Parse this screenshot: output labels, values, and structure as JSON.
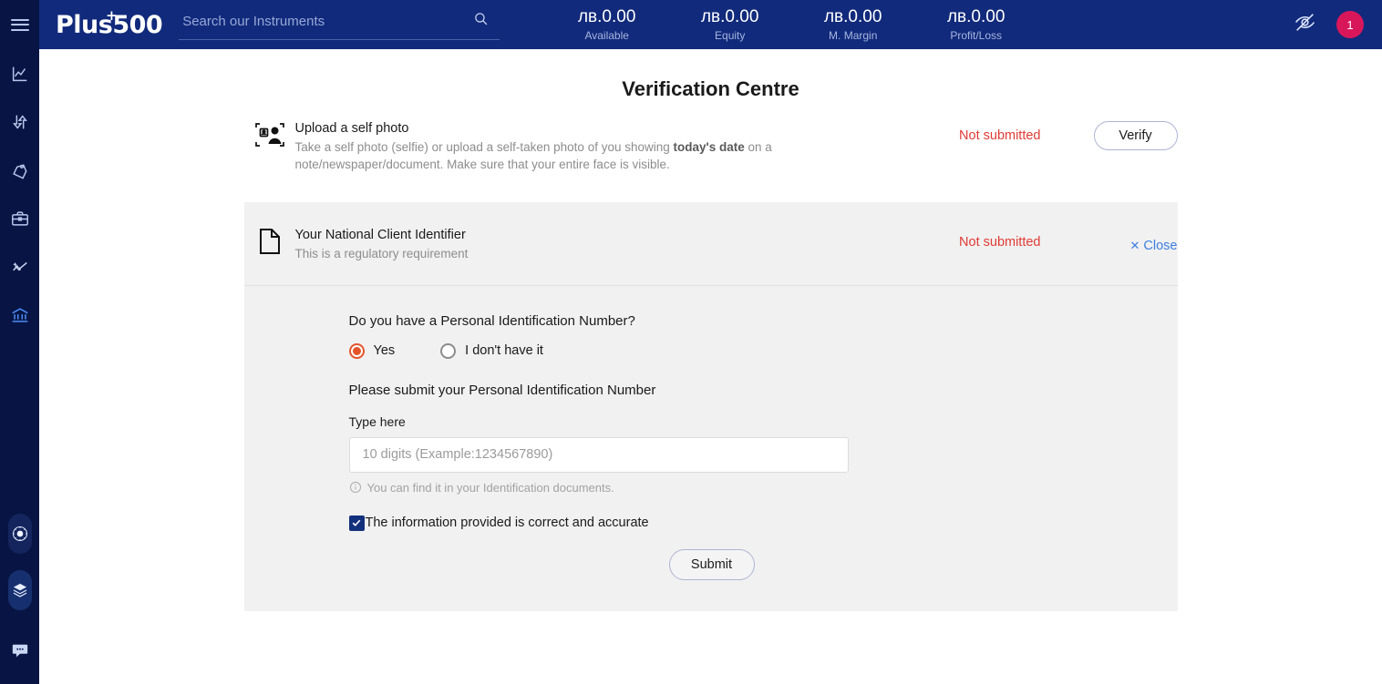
{
  "app": {
    "brand": "Plus500",
    "brand_plus_glyph": "+"
  },
  "search": {
    "placeholder": "Search our Instruments",
    "value": ""
  },
  "header": {
    "balances": [
      {
        "value": "лв.0.00",
        "label": "Available"
      },
      {
        "value": "лв.0.00",
        "label": "Equity"
      },
      {
        "value": "лв.0.00",
        "label": "M. Margin"
      },
      {
        "value": "лв.0.00",
        "label": "Profit/Loss"
      }
    ],
    "hide_balances_icon": "eye-slash-icon",
    "notification_count": "1",
    "notification_color": "#d8175a"
  },
  "sidebar": {
    "items": [
      {
        "icon": "chart-line-icon",
        "active": false
      },
      {
        "icon": "trade-arrows-icon",
        "active": false
      },
      {
        "icon": "tag-icon",
        "active": false
      },
      {
        "icon": "briefcase-icon",
        "active": false
      },
      {
        "icon": "insights-icon",
        "active": false
      },
      {
        "icon": "bank-icon",
        "active": true
      }
    ],
    "bottom_items": [
      {
        "icon": "brightness-dial-icon"
      },
      {
        "icon": "layers-stack-icon"
      },
      {
        "icon": "chat-bubble-icon"
      }
    ]
  },
  "main": {
    "title": "Verification Centre",
    "selfie_row": {
      "icon": "selfie-id-icon",
      "title": "Upload a self photo",
      "desc_part1": "Take a self photo (selfie) or upload a self-taken photo of you showing ",
      "desc_bold": "today's date",
      "desc_part2": " on a note/newspaper/document. Make sure that your entire face is visible.",
      "status": "Not submitted",
      "status_color": "#e03b35",
      "action_label": "Verify"
    },
    "nci_card": {
      "icon": "document-icon",
      "title": "Your National Client Identifier",
      "subtitle": "This is a regulatory requirement",
      "status": "Not submitted",
      "status_color": "#e03b35",
      "close_label": "Close",
      "close_glyph": "✕",
      "close_color": "#3d7fe0",
      "question": "Do you have a Personal Identification Number?",
      "options": [
        {
          "label": "Yes",
          "selected": true
        },
        {
          "label": "I don't have it",
          "selected": false
        }
      ],
      "radio_accent": "#e4542a",
      "sub_instruction": "Please submit your Personal Identification Number",
      "field_label": "Type here",
      "field_placeholder": "10 digits (Example:1234567890)",
      "field_value": "",
      "hint_icon": "info-circle-icon",
      "hint": "You can find it in your Identification documents.",
      "consent_label": "The information provided is correct and accurate",
      "consent_checked": true,
      "consent_color": "#13307d",
      "submit_label": "Submit"
    }
  }
}
